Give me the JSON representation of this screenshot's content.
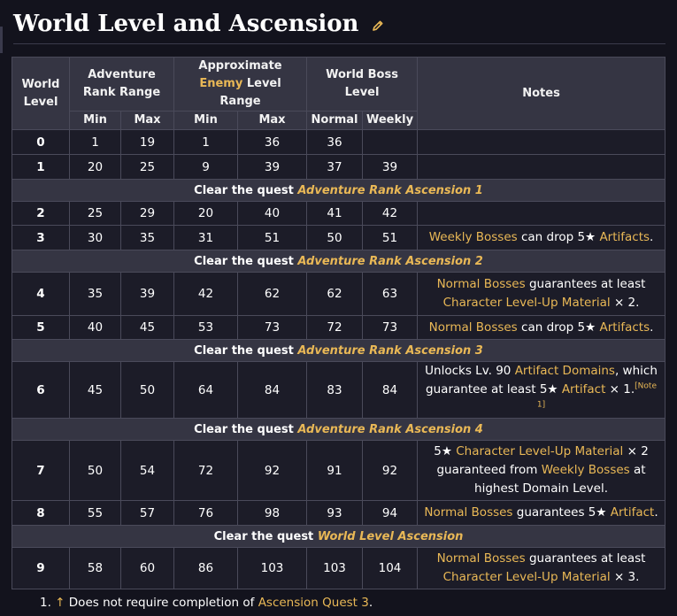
{
  "page": {
    "title": "World Level and Ascension"
  },
  "table": {
    "headers": {
      "world_level": [
        "World",
        "Level"
      ],
      "adventure_rank_range": [
        "Adventure",
        "Rank Range"
      ],
      "approx_enemy_level": {
        "line1": "Approximate",
        "enemy": "Enemy",
        "rest": " Level Range"
      },
      "world_boss_level": [
        "World Boss",
        "Level"
      ],
      "notes": "Notes",
      "min": "Min",
      "max": "Max",
      "normal": "Normal",
      "weekly": "Weekly"
    },
    "quest_prefix": "Clear the quest ",
    "rows": [
      {
        "type": "data",
        "wl": "0",
        "ar_min": "1",
        "ar_max": "19",
        "en_min": "1",
        "en_max": "36",
        "wb_normal": "36",
        "wb_weekly": "",
        "note": []
      },
      {
        "type": "data",
        "wl": "1",
        "ar_min": "20",
        "ar_max": "25",
        "en_min": "9",
        "en_max": "39",
        "wb_normal": "37",
        "wb_weekly": "39",
        "note": []
      },
      {
        "type": "quest",
        "quest": "Adventure Rank Ascension 1"
      },
      {
        "type": "data",
        "wl": "2",
        "ar_min": "25",
        "ar_max": "29",
        "en_min": "20",
        "en_max": "40",
        "wb_normal": "41",
        "wb_weekly": "42",
        "note": []
      },
      {
        "type": "data",
        "wl": "3",
        "ar_min": "30",
        "ar_max": "35",
        "en_min": "31",
        "en_max": "51",
        "wb_normal": "50",
        "wb_weekly": "51",
        "note": [
          [
            {
              "t": "Weekly Bosses",
              "g": true
            },
            {
              "t": " can drop 5★ "
            },
            {
              "t": "Artifacts",
              "g": true
            },
            {
              "t": "."
            }
          ]
        ]
      },
      {
        "type": "quest",
        "quest": "Adventure Rank Ascension 2"
      },
      {
        "type": "data",
        "wl": "4",
        "ar_min": "35",
        "ar_max": "39",
        "en_min": "42",
        "en_max": "62",
        "wb_normal": "62",
        "wb_weekly": "63",
        "note": [
          [
            {
              "t": "Normal Bosses",
              "g": true
            },
            {
              "t": " guarantees at least"
            }
          ],
          [
            {
              "t": "Character Level-Up Material",
              "g": true
            },
            {
              "t": " × 2."
            }
          ]
        ]
      },
      {
        "type": "data",
        "wl": "5",
        "ar_min": "40",
        "ar_max": "45",
        "en_min": "53",
        "en_max": "73",
        "wb_normal": "72",
        "wb_weekly": "73",
        "note": [
          [
            {
              "t": "Normal Bosses",
              "g": true
            },
            {
              "t": " can drop 5★ "
            },
            {
              "t": "Artifacts",
              "g": true
            },
            {
              "t": "."
            }
          ]
        ]
      },
      {
        "type": "quest",
        "quest": "Adventure Rank Ascension 3"
      },
      {
        "type": "data",
        "wl": "6",
        "ar_min": "45",
        "ar_max": "50",
        "en_min": "64",
        "en_max": "84",
        "wb_normal": "83",
        "wb_weekly": "84",
        "note": [
          [
            {
              "t": "Unlocks Lv. 90 "
            },
            {
              "t": "Artifact Domains",
              "g": true
            },
            {
              "t": ", which"
            }
          ],
          [
            {
              "t": "guarantee at least 5★ "
            },
            {
              "t": "Artifact",
              "g": true
            },
            {
              "t": " × 1."
            },
            {
              "t": "[Note 1]",
              "g": true,
              "sup": true
            }
          ]
        ]
      },
      {
        "type": "quest",
        "quest": "Adventure Rank Ascension 4"
      },
      {
        "type": "data",
        "wl": "7",
        "ar_min": "50",
        "ar_max": "54",
        "en_min": "72",
        "en_max": "92",
        "wb_normal": "91",
        "wb_weekly": "92",
        "note": [
          [
            {
              "t": "5★ "
            },
            {
              "t": "Character Level-Up Material",
              "g": true
            },
            {
              "t": " × 2"
            }
          ],
          [
            {
              "t": "guaranteed from "
            },
            {
              "t": "Weekly Bosses",
              "g": true
            },
            {
              "t": " at"
            }
          ],
          [
            {
              "t": "highest Domain Level."
            }
          ]
        ]
      },
      {
        "type": "data",
        "wl": "8",
        "ar_min": "55",
        "ar_max": "57",
        "en_min": "76",
        "en_max": "98",
        "wb_normal": "93",
        "wb_weekly": "94",
        "note": [
          [
            {
              "t": "Normal Bosses",
              "g": true
            },
            {
              "t": " guarantees 5★ "
            },
            {
              "t": "Artifact",
              "g": true
            },
            {
              "t": "."
            }
          ]
        ]
      },
      {
        "type": "quest",
        "quest": "World Level Ascension"
      },
      {
        "type": "data",
        "wl": "9",
        "ar_min": "58",
        "ar_max": "60",
        "en_min": "86",
        "en_max": "103",
        "wb_normal": "103",
        "wb_weekly": "104",
        "note": [
          [
            {
              "t": "Normal Bosses",
              "g": true
            },
            {
              "t": " guarantees at least"
            }
          ],
          [
            {
              "t": "Character Level-Up Material",
              "g": true
            },
            {
              "t": " × 3."
            }
          ]
        ]
      }
    ]
  },
  "footnotes": [
    {
      "number": "1.",
      "arrow": "↑",
      "text": " Does not require completion of ",
      "link": "Ascension Quest 3",
      "end": "."
    }
  ],
  "colors": {
    "accent": "#e9b856",
    "header_bg": "#353543",
    "cell_bg": "#1c1c28",
    "page_bg": "#13131d"
  },
  "icons": {
    "title_edit": "pencil-icon"
  }
}
